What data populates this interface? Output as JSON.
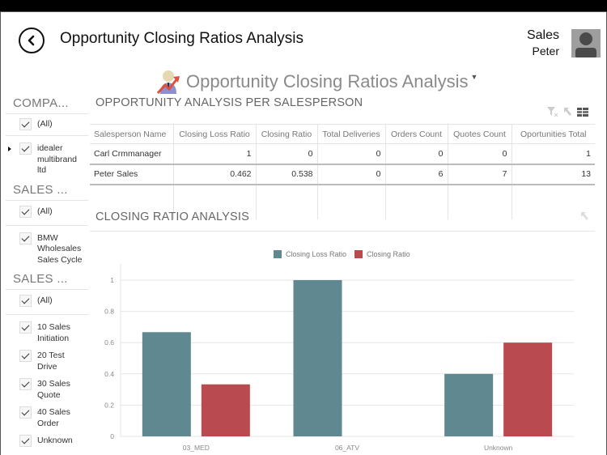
{
  "header": {
    "title": "Opportunity Closing Ratios Analysis",
    "user_role": "Sales",
    "user_name": "Peter"
  },
  "dashboard": {
    "title": "Opportunity Closing Ratios Analysis"
  },
  "filters": [
    {
      "header": "COMPA...",
      "items": [
        {
          "label": "(All)",
          "checked": true
        },
        {
          "label": "idealer multibrand ltd",
          "checked": true,
          "expandable": true
        }
      ]
    },
    {
      "header": "SALES ...",
      "items": [
        {
          "label": "(All)",
          "checked": true
        },
        {
          "label": "BMW Wholesales Sales Cycle",
          "checked": true
        }
      ]
    },
    {
      "header": "SALES ...",
      "items": [
        {
          "label": "(All)",
          "checked": true
        },
        {
          "label": "10 Sales Initiation",
          "checked": true
        },
        {
          "label": "20 Test Drive",
          "checked": true
        },
        {
          "label": "30 Sales Quote",
          "checked": true
        },
        {
          "label": "40 Sales Order",
          "checked": true
        },
        {
          "label": "Unknown",
          "checked": true
        }
      ]
    }
  ],
  "table_widget": {
    "title": "OPPORTUNITY ANALYSIS PER SALESPERSON",
    "columns": [
      "Salesperson Name",
      "Closing Loss Ratio",
      "Closing Ratio",
      "Total Deliveries",
      "Orders Count",
      "Quotes Count",
      "Oportunities Total"
    ],
    "rows": [
      [
        "Carl Crmmanager",
        "1",
        "0",
        "0",
        "0",
        "0",
        "1"
      ],
      [
        "Peter Sales",
        "0.462",
        "0.538",
        "0",
        "6",
        "7",
        "13"
      ]
    ]
  },
  "chart_widget": {
    "title": "CLOSING RATIO ANALYSIS"
  },
  "chart_data": {
    "type": "bar",
    "title": "CLOSING RATIO ANALYSIS",
    "categories": [
      "03_MED",
      "06_ATV",
      "Unknown"
    ],
    "series": [
      {
        "name": "Closing Loss Ratio",
        "color": "#5f8891",
        "values": [
          0.667,
          1,
          0.4
        ]
      },
      {
        "name": "Closing Ratio",
        "color": "#b94a50",
        "values": [
          0.333,
          0,
          0.6
        ]
      }
    ],
    "xlabel": "",
    "ylabel": "",
    "ylim": [
      0,
      1
    ],
    "yticks": [
      "0",
      "0.2",
      "0.4",
      "0.6",
      "0.8",
      "1"
    ],
    "grid": true,
    "legend": "top-center"
  }
}
